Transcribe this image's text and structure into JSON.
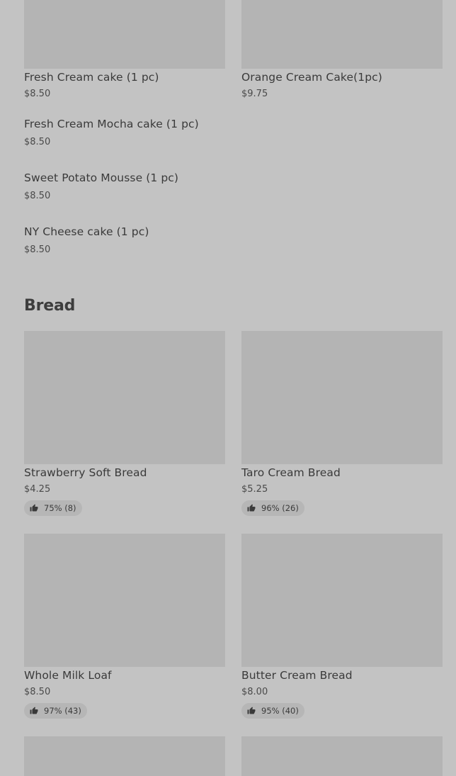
{
  "cakes": [
    {
      "name": "Fresh Cream cake (1 pc)",
      "price": "$8.50"
    },
    {
      "name": "Orange Cream Cake(1pc)",
      "price": "$9.75"
    },
    {
      "name": "Fresh Cream Mocha cake (1 pc)",
      "price": "$8.50"
    },
    {
      "name": "Sweet Potato Mousse (1 pc)",
      "price": "$8.50"
    },
    {
      "name": "NY Cheese cake (1 pc)",
      "price": "$8.50"
    }
  ],
  "bread": {
    "title": "Bread",
    "items": [
      {
        "name": "Strawberry Soft Bread",
        "price": "$4.25",
        "rating": "75% (8)"
      },
      {
        "name": "Taro Cream Bread",
        "price": "$5.25",
        "rating": "96% (26)"
      },
      {
        "name": "Whole Milk Loaf",
        "price": "$8.50",
        "rating": "97% (43)"
      },
      {
        "name": "Butter Cream Bread",
        "price": "$8.00",
        "rating": "95% (40)"
      }
    ]
  },
  "icons": {
    "rating": "thumbs-up-icon"
  },
  "colors": {
    "background": "#c3c3c3",
    "placeholder": "#b4b4b4",
    "text": "#3a3a3a"
  }
}
